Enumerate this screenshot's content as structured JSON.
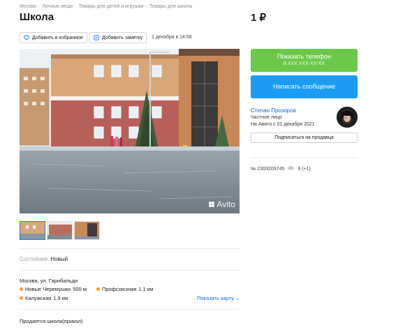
{
  "breadcrumbs": [
    "Москва",
    "Личные вещи",
    "Товары для детей и игрушки",
    "Товары для школы"
  ],
  "listing": {
    "title": "Школа",
    "price": "1 ₽",
    "favorite_label": "Добавить в избранное",
    "note_label": "Добавить заметку",
    "date": "1 декабря в 14:56",
    "photo_watermark": "Avito",
    "thumbnails_count": 3,
    "condition_label": "Состояние:",
    "condition_value": "Новый",
    "address": "Москва, ул. Гарибальди",
    "metro": [
      {
        "name": "Новые Черемушки",
        "distance": "500 м"
      },
      {
        "name": "Профсоюзная",
        "distance": "1,1 км"
      },
      {
        "name": "Калужская",
        "distance": "1,9 км"
      }
    ],
    "show_map_label": "Показать карту",
    "description": "Продается школа(прикол)"
  },
  "actions": {
    "phone_label": "Показать телефон",
    "phone_masked": "8 XXX XXX-XX-XX",
    "message_label": "Написать сообщение",
    "subscribe_label": "Подписаться на продавца"
  },
  "seller": {
    "name": "Степан Прозоров",
    "type": "Частное лицо",
    "since": "На Авито с 01 декабря 2021"
  },
  "meta": {
    "ad_number": "№ 2303209745",
    "views": "9 (+1)"
  },
  "colors": {
    "phone_button": "#6cc84a",
    "message_button": "#1b9cf2",
    "link": "#0a6ad0",
    "metro_dot": "#ff9b2f"
  }
}
